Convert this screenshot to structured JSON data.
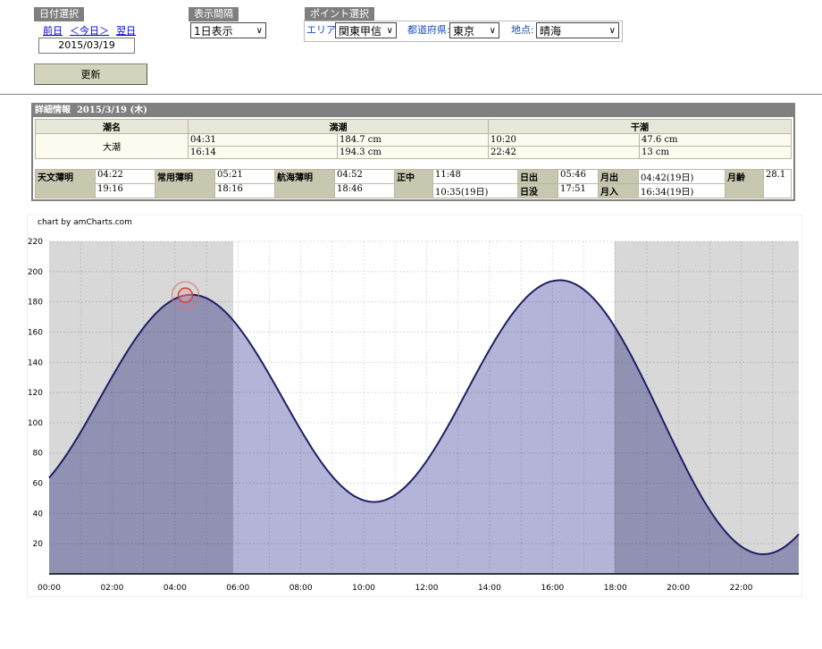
{
  "date_select": {
    "title": "日付選択",
    "prev": "前日",
    "today": "＜今日＞",
    "next": "翌日",
    "date": "2015/03/19"
  },
  "interval_select": {
    "title": "表示間隔",
    "value": "1日表示"
  },
  "point_select": {
    "title": "ポイント選択",
    "area_label": "エリア:",
    "area_value": "関東甲信",
    "pref_label": "都道府県:",
    "pref_value": "東京",
    "place_label": "地点:",
    "place_value": "晴海"
  },
  "update_button": "更新",
  "detail": {
    "title": "詳細情報",
    "date": "2015/3/19 (木)",
    "tide_headers": {
      "name": "潮名",
      "high": "満潮",
      "low": "干潮"
    },
    "tide_name": "大潮",
    "high": [
      {
        "time": "04:31",
        "level": "184.7 cm"
      },
      {
        "time": "16:14",
        "level": "194.3 cm"
      }
    ],
    "low": [
      {
        "time": "10:20",
        "level": "47.6 cm"
      },
      {
        "time": "22:42",
        "level": "13 cm"
      }
    ],
    "sun": {
      "astro_label": "天文薄明",
      "astro_1": "04:22",
      "astro_2": "19:16",
      "civil_label": "常用薄明",
      "civil_1": "05:21",
      "civil_2": "18:16",
      "naut_label": "航海薄明",
      "naut_1": "04:52",
      "naut_2": "18:46",
      "noon_label": "正中",
      "noon_1": "11:48",
      "noon_2": "10:35(19日)",
      "sunrise_label": "日出",
      "sunrise": "05:46",
      "sunset_label": "日没",
      "sunset": "17:51",
      "moonrise_label": "月出",
      "moonrise": "04:42(19日)",
      "moonset_label": "月入",
      "moonset": "16:34(19日)",
      "moonage_label": "月齢",
      "moonage": "28.1"
    }
  },
  "chart_credit": "chart by amCharts.com",
  "chart_data": {
    "type": "area",
    "x_ticks": [
      "00:00",
      "02:00",
      "04:00",
      "06:00",
      "08:00",
      "10:00",
      "12:00",
      "14:00",
      "16:00",
      "18:00",
      "20:00",
      "22:00"
    ],
    "y_ticks": [
      20,
      40,
      60,
      80,
      100,
      120,
      140,
      160,
      180,
      200,
      220
    ],
    "xlim": [
      0,
      23.83
    ],
    "ylim": [
      0,
      220
    ],
    "grid": true,
    "night_bands": [
      [
        0,
        5.85
      ],
      [
        17.97,
        23.83
      ]
    ],
    "extrema": [
      {
        "x": 4.52,
        "y": 184.7
      },
      {
        "x": 10.33,
        "y": 47.6
      },
      {
        "x": 16.23,
        "y": 194.3
      },
      {
        "x": 22.7,
        "y": 13
      }
    ],
    "start_value": 53,
    "end_value": 27,
    "marker_x": 4.33,
    "colors": {
      "line": "#1f1f66",
      "fill": "#b0b0d6",
      "night": "#d8d8d8",
      "night_fill": "#9191b3"
    }
  }
}
